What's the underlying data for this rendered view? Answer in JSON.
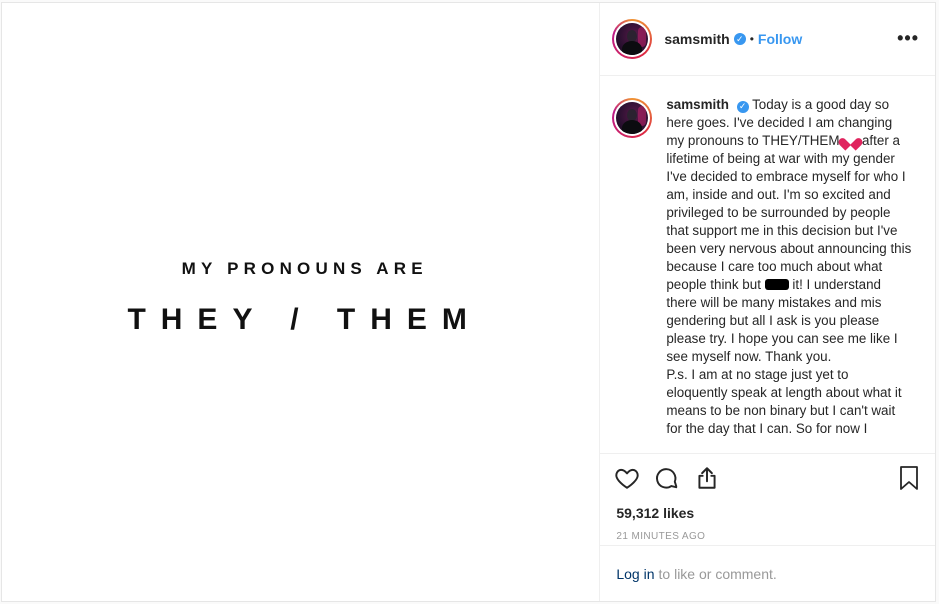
{
  "media": {
    "line1": "MY PRONOUNS ARE",
    "line2": "THEY / THEM"
  },
  "header": {
    "username": "samsmith",
    "separator": "•",
    "follow_label": "Follow",
    "more_label": "•••"
  },
  "caption": {
    "username": "samsmith",
    "part1": "Today is a good day so here goes. I've decided I am changing my pronouns to THEY/THEM",
    "part2": "after a lifetime of being at war with my gender I've decided to embrace myself for who I am, inside and out. I'm so excited and privileged to be surrounded by people that support me in this decision but I've been very nervous about announcing this because I care too much about what people think but",
    "part3": "it! I understand there will be many mistakes and mis gendering but all I ask is you please please try. I hope you can see me like I see myself now. Thank you.\nP.s. I am at no stage just yet to eloquently speak at length about what it means to be non binary but I can't wait for the day that I can. So for now I",
    "emoji": "heart",
    "redacted": "f**k"
  },
  "actions": {
    "like_icon": "heart-outline-icon",
    "comment_icon": "comment-icon",
    "share_icon": "share-icon",
    "save_icon": "bookmark-icon"
  },
  "likes": "59,312 likes",
  "timestamp": "21 MINUTES AGO",
  "login": {
    "link": "Log in",
    "suffix": "to like or comment."
  },
  "colors": {
    "accent": "#3897f0",
    "link_dark": "#003569",
    "muted": "#999999",
    "border": "#efefef"
  }
}
